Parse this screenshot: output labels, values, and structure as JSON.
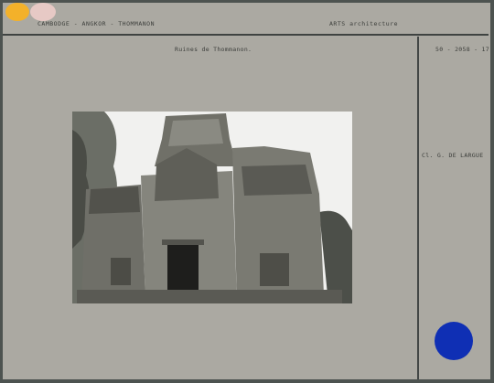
{
  "header": {
    "location": "CAMBODGE - ANGKOR - THOMMANON",
    "category": "ARTS architecture"
  },
  "caption": {
    "title": "Ruines de Thommanon.",
    "reference": "50 - 2058 - 17",
    "credit": "Cl. G. DE LARGUE"
  },
  "colors": {
    "accent_orange": "#f3b12a",
    "accent_pink": "#e7c9c5",
    "accent_blue": "#0f2fb4"
  }
}
